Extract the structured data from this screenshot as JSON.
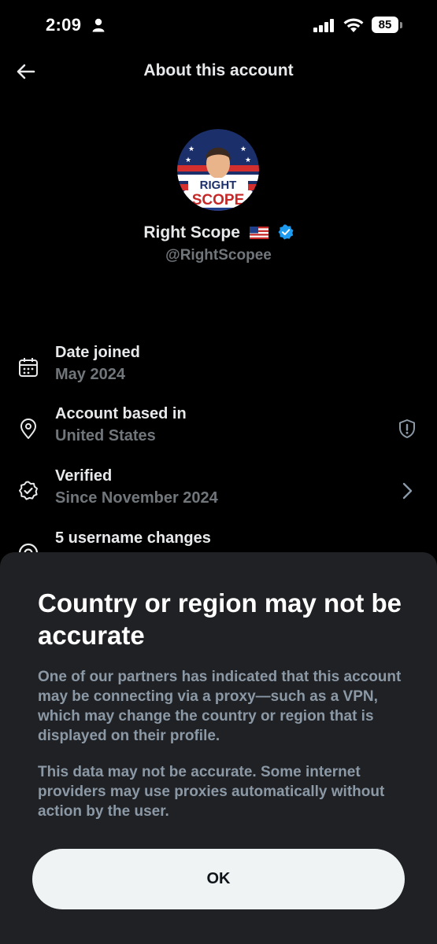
{
  "status_bar": {
    "time": "2:09",
    "battery": "85"
  },
  "nav": {
    "title": "About this account"
  },
  "profile": {
    "name": "Right Scope",
    "handle": "@RightScopee",
    "avatar_text_1": "RIGHT",
    "avatar_text_2": "SCOPE"
  },
  "details": [
    {
      "label": "Date joined",
      "value": "May 2024",
      "icon": "calendar-icon"
    },
    {
      "label": "Account based in",
      "value": "United States",
      "icon": "location-pin-icon"
    },
    {
      "label": "Verified",
      "value": "Since November 2024",
      "icon": "verified-badge-icon"
    },
    {
      "label": "5 username changes",
      "value": "",
      "icon": "at-sign-icon"
    }
  ],
  "dialog": {
    "title": "Country or region may not be accurate",
    "paragraph_1": "One of our partners has indicated that this account may be connecting via a proxy—such as a VPN, which may change the country or region that is displayed on their profile.",
    "paragraph_2": "This data may not be accurate. Some internet providers may use proxies automatically without action by the user.",
    "ok_label": "OK"
  },
  "colors": {
    "background": "#000000",
    "sheet": "#202124",
    "muted_text": "#71767b",
    "verified_blue": "#1d9bf0",
    "button": "#eff3f4"
  }
}
